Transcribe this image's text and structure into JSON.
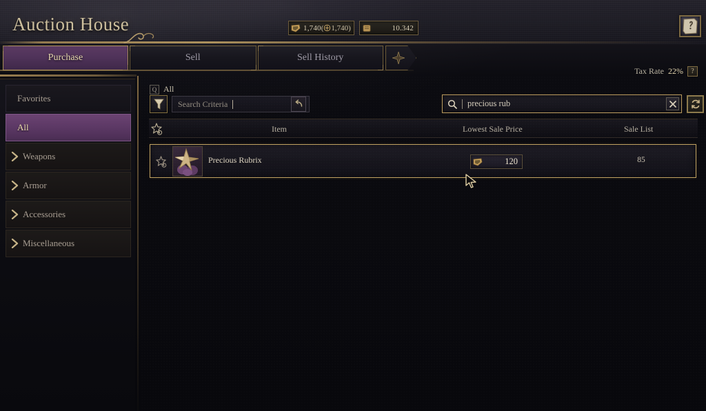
{
  "window": {
    "title": "Auction House"
  },
  "currency": {
    "solar_icon": "shell-coin-icon",
    "solar_value": "1,740",
    "solar_bound_icon": "bound-currency-icon",
    "solar_bound_value": "1,740)",
    "solar_paren_open": "(",
    "gold_icon": "gold-pouch-icon",
    "gold_value": "10.342"
  },
  "help": {
    "book_icon": "help-book-icon",
    "question_icon": "question-mark-icon",
    "question_glyph": "?"
  },
  "tabs": {
    "items": [
      {
        "id": "purchase",
        "label": "Purchase",
        "active": true
      },
      {
        "id": "sell",
        "label": "Sell",
        "active": false
      },
      {
        "id": "sell-history",
        "label": "Sell History",
        "active": false
      }
    ],
    "ornament_icon": "diamond-star-ornament-icon"
  },
  "tax": {
    "label": "Tax Rate",
    "value": "22%",
    "help_glyph": "?"
  },
  "sidebar": {
    "items": [
      {
        "id": "favorites",
        "label": "Favorites",
        "type": "plain",
        "selected": false,
        "chevron": false
      },
      {
        "id": "all",
        "label": "All",
        "type": "plain",
        "selected": true,
        "chevron": false
      },
      {
        "id": "weapons",
        "label": "Weapons",
        "type": "category",
        "selected": false,
        "chevron": true
      },
      {
        "id": "armor",
        "label": "Armor",
        "type": "category",
        "selected": false,
        "chevron": true
      },
      {
        "id": "accessories",
        "label": "Accessories",
        "type": "category",
        "selected": false,
        "chevron": true
      },
      {
        "id": "miscellaneous",
        "label": "Miscellaneous",
        "type": "category",
        "selected": false,
        "chevron": true
      }
    ],
    "chevron_icon": "chevron-right-icon"
  },
  "breadcrumb": {
    "badge_glyph": "Q",
    "badge_icon": "category-badge-icon",
    "label": "All"
  },
  "criteria": {
    "filter_icon": "funnel-filter-icon",
    "placeholder": "Search Criteria",
    "value": "",
    "reset_icon": "undo-reset-icon"
  },
  "search": {
    "search_icon": "magnifier-icon",
    "value": "precious rub",
    "clear_icon": "close-x-icon",
    "refresh_icon": "refresh-circular-arrows-icon"
  },
  "table": {
    "favorite_header_icon": "star-add-icon",
    "columns": [
      {
        "id": "favorite",
        "label": ""
      },
      {
        "id": "item",
        "label": "Item"
      },
      {
        "id": "lowest_sale_price",
        "label": "Lowest Sale Price"
      },
      {
        "id": "sale_list",
        "label": "Sale List"
      }
    ],
    "rows": [
      {
        "favorite_icon": "star-add-icon",
        "item_icon": "precious-rubrix-gem-icon",
        "item_name": "Precious Rubrix",
        "price_icon": "shell-coin-icon",
        "lowest_sale_price": "120",
        "sale_list": "85",
        "selected": true
      }
    ]
  },
  "cursor": {
    "icon": "mouse-cursor-icon"
  }
}
